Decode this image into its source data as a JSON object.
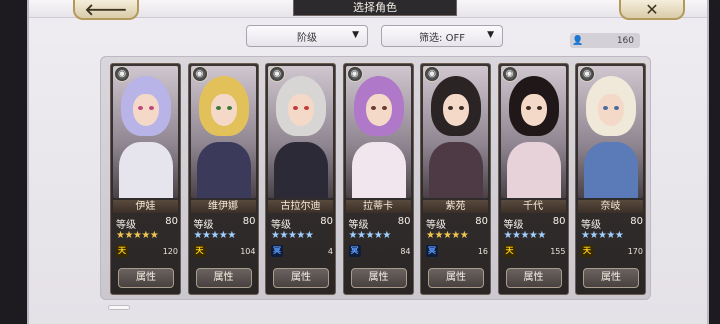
{
  "header": {
    "title": "选择角色",
    "back_icon": "arrow-left-icon",
    "close_icon": "close-x-icon"
  },
  "filters": {
    "rank_label": "阶级",
    "filter_label": "筛选: OFF"
  },
  "roster": {
    "count": "160",
    "person_icon": "person-icon"
  },
  "labels": {
    "level": "等级",
    "attributes_button": "属性"
  },
  "characters": [
    {
      "name": "伊娃",
      "level": "80",
      "star_type": "gold",
      "stars": 5,
      "badge": "天",
      "badge_type": "gold",
      "count": "120",
      "hair": "#b8b4e8",
      "body": "#e6e4ec",
      "eye": "#c2457a"
    },
    {
      "name": "维伊娜",
      "level": "80",
      "star_type": "blue",
      "stars": 5,
      "badge": "天",
      "badge_type": "gold",
      "count": "104",
      "hair": "#e2c15a",
      "body": "#3b3a5a",
      "eye": "#3a7a3a"
    },
    {
      "name": "古拉尔迪",
      "level": "80",
      "star_type": "blue",
      "stars": 5,
      "badge": "冥",
      "badge_type": "blue",
      "count": "4",
      "hair": "#d8d6d4",
      "body": "#2c2a36",
      "eye": "#c23a3a"
    },
    {
      "name": "拉蒂卡",
      "level": "80",
      "star_type": "blue",
      "stars": 5,
      "badge": "冥",
      "badge_type": "blue",
      "count": "84",
      "hair": "#b078c8",
      "body": "#f2e6ee",
      "eye": "#6a3a2a"
    },
    {
      "name": "紫苑",
      "level": "80",
      "star_type": "gold",
      "stars": 5,
      "badge": "冥",
      "badge_type": "blue",
      "count": "16",
      "hair": "#2a2424",
      "body": "#4e3a44",
      "eye": "#3a2a20"
    },
    {
      "name": "千代",
      "level": "80",
      "star_type": "blue",
      "stars": 5,
      "badge": "天",
      "badge_type": "gold",
      "count": "155",
      "hair": "#201818",
      "body": "#e8d2da",
      "eye": "#3a2a22"
    },
    {
      "name": "奈岐",
      "level": "80",
      "star_type": "blue",
      "stars": 5,
      "badge": "天",
      "badge_type": "gold",
      "count": "170",
      "hair": "#f0e8d8",
      "body": "#5a7ab8",
      "eye": "#4a6aa0"
    }
  ]
}
